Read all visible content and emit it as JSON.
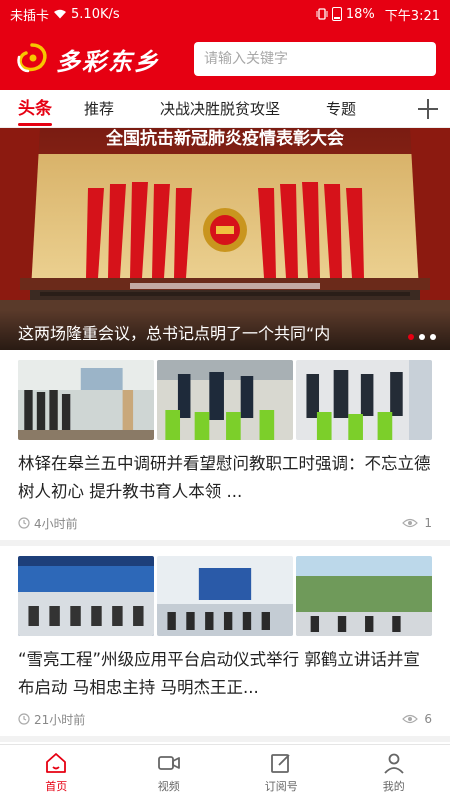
{
  "status_bar": {
    "sim": "未插卡",
    "speed": "5.10K/s",
    "battery": "18%",
    "time": "下午3:21"
  },
  "header": {
    "logo_text": "多彩东乡",
    "search_placeholder": "请输入关键字"
  },
  "tabs": [
    {
      "label": "头条",
      "active": true
    },
    {
      "label": "推荐"
    },
    {
      "label": "决战决胜脱贫攻坚"
    },
    {
      "label": "专题"
    }
  ],
  "banner": {
    "stage_text": "全国抗击新冠肺炎疫情表彰大会",
    "caption": "这两场隆重会议，总书记点明了一个共同“内",
    "slide_index": 1,
    "slide_count": 3
  },
  "feed": [
    {
      "title": "林铎在皋兰五中调研并看望慰问教职工时强调：不忘立德树人初心 提升教书育人本领 ...",
      "time": "4小时前",
      "views": "1"
    },
    {
      "title": "“雪亮工程”州级应用平台启动仪式举行 郭鹤立讲话并宣布启动 马相忠主持 马明杰王正...",
      "time": "21小时前",
      "views": "6"
    }
  ],
  "bottom_nav": [
    {
      "label": "首页",
      "icon": "home-icon",
      "active": true
    },
    {
      "label": "视频",
      "icon": "video-icon"
    },
    {
      "label": "订阅号",
      "icon": "subscribe-icon"
    },
    {
      "label": "我的",
      "icon": "profile-icon"
    }
  ],
  "colors": {
    "brand_red": "#e60012",
    "text": "#222222",
    "muted": "#888888"
  }
}
